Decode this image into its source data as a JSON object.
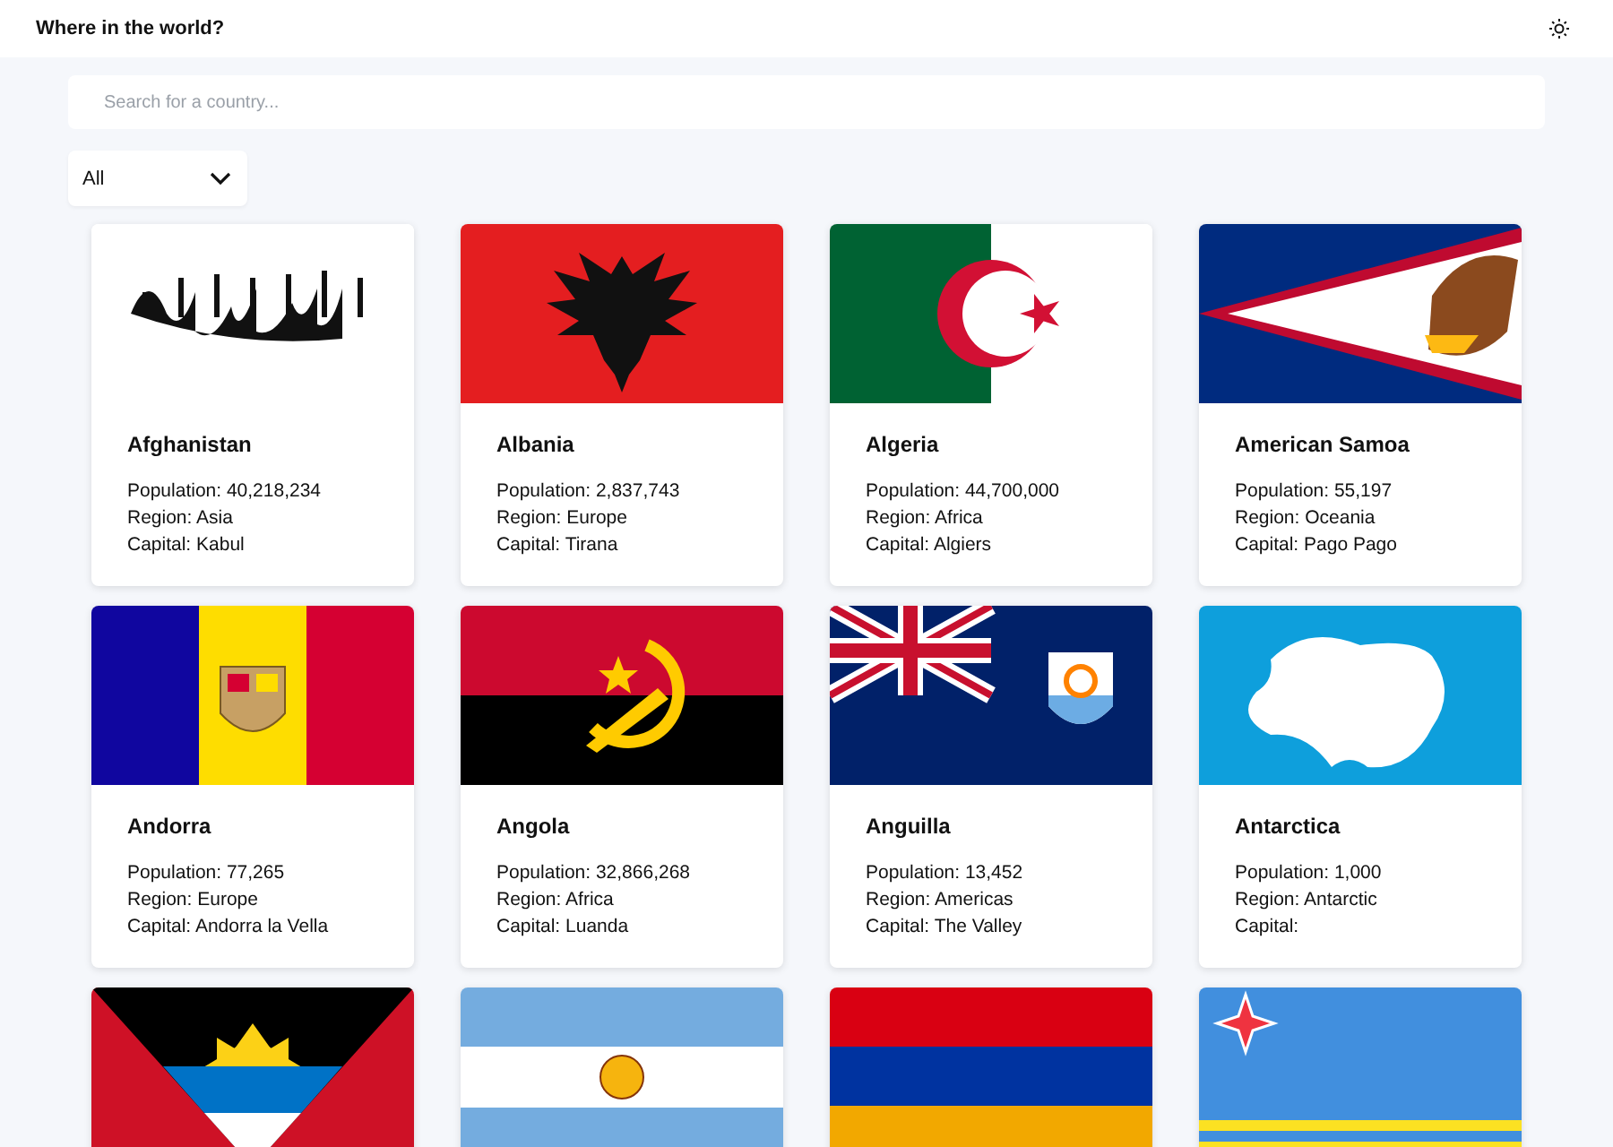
{
  "header": {
    "title": "Where in the world?"
  },
  "search": {
    "placeholder": "Search for a country..."
  },
  "region_filter": {
    "value": "All"
  },
  "cards": [
    {
      "kind": "afghanistan",
      "name": "Afghanistan",
      "population": "Population: 40,218,234",
      "region": "Region: Asia",
      "capital": "Capital: Kabul"
    },
    {
      "kind": "albania",
      "name": "Albania",
      "population": "Population: 2,837,743",
      "region": "Region: Europe",
      "capital": "Capital: Tirana"
    },
    {
      "kind": "algeria",
      "name": "Algeria",
      "population": "Population: 44,700,000",
      "region": "Region: Africa",
      "capital": "Capital: Algiers"
    },
    {
      "kind": "samoa",
      "name": "American Samoa",
      "population": "Population: 55,197",
      "region": "Region: Oceania",
      "capital": "Capital: Pago Pago"
    },
    {
      "kind": "andorra",
      "name": "Andorra",
      "population": "Population: 77,265",
      "region": "Region: Europe",
      "capital": "Capital: Andorra la Vella"
    },
    {
      "kind": "angola",
      "name": "Angola",
      "population": "Population: 32,866,268",
      "region": "Region: Africa",
      "capital": "Capital: Luanda"
    },
    {
      "kind": "anguilla",
      "name": "Anguilla",
      "population": "Population: 13,452",
      "region": "Region: Americas",
      "capital": "Capital: The Valley"
    },
    {
      "kind": "antarctica",
      "name": "Antarctica",
      "population": "Population: 1,000",
      "region": "Region: Antarctic",
      "capital": "Capital:"
    },
    {
      "kind": "antigua"
    },
    {
      "kind": "argentina"
    },
    {
      "kind": "armenia"
    },
    {
      "kind": "aruba"
    }
  ]
}
